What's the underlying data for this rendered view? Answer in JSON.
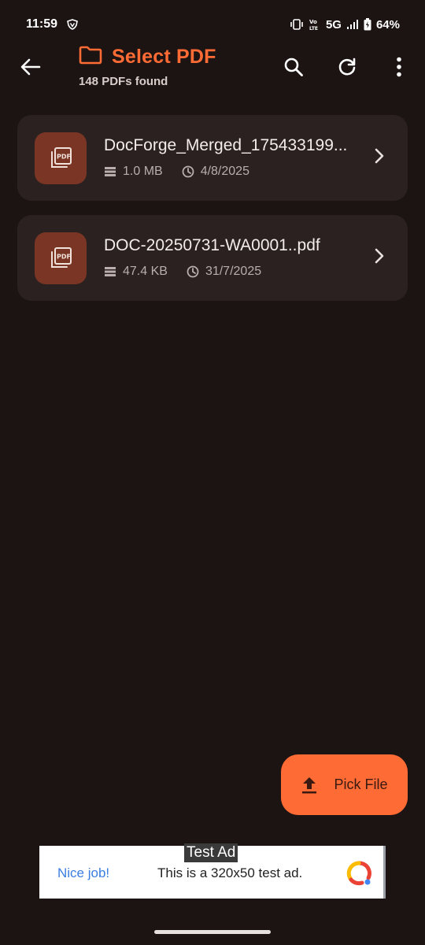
{
  "status_bar": {
    "time": "11:59",
    "network": "5G",
    "volte": "Vo LTE",
    "battery": "64%"
  },
  "header": {
    "title": "Select PDF",
    "subtitle": "148 PDFs found"
  },
  "files": [
    {
      "icon_label": "PDF",
      "name": "DocForge_Merged_175433199...",
      "size": "1.0 MB",
      "date": "4/8/2025"
    },
    {
      "icon_label": "PDF",
      "name": "DOC-20250731-WA0001..pdf",
      "size": "47.4 KB",
      "date": "31/7/2025"
    }
  ],
  "fab": {
    "label": "Pick File"
  },
  "ad": {
    "tag": "Test Ad",
    "headline": "Nice job!",
    "body": "This is a 320x50 test ad."
  },
  "colors": {
    "background": "#1c1413",
    "accent": "#ff6b35",
    "card": "#2a2120",
    "icon_tile": "#7a3524"
  }
}
